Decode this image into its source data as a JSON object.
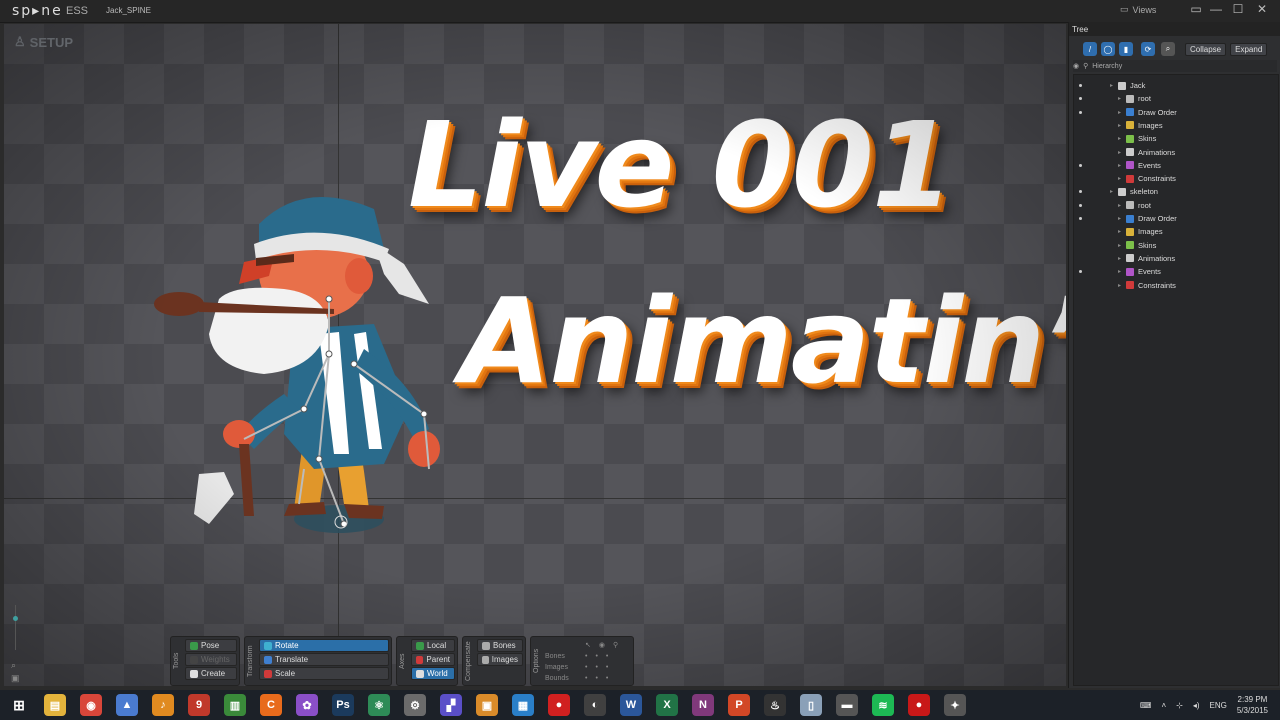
{
  "app": {
    "logo": "sp▸ne",
    "edition": "ESS",
    "project": "Jack_SPINE",
    "views_label": "Views"
  },
  "window_controls": [
    "▭",
    "—",
    "☐",
    "✕"
  ],
  "viewport": {
    "mode": "SETUP"
  },
  "overlay": {
    "line1": "Live 001",
    "line2": "Animatin’"
  },
  "toolbar": {
    "tools": {
      "label": "Tools",
      "pose": "Pose",
      "weights": "Weights",
      "create": "Create"
    },
    "transform": {
      "label": "Transform",
      "rotate": "Rotate",
      "translate": "Translate",
      "scale": "Scale"
    },
    "axes": {
      "label": "Axes",
      "local": "Local",
      "parent": "Parent",
      "world": "World"
    },
    "compensate": {
      "label": "Compensate",
      "bones": "Bones",
      "images": "Images"
    },
    "options": {
      "label": "Options",
      "rows": [
        "Bones",
        "Images",
        "Bounds"
      ]
    }
  },
  "tree": {
    "tab": "Tree",
    "collapse": "Collapse",
    "expand": "Expand",
    "hierarchy": "Hierarchy",
    "items": [
      {
        "label": "Jack",
        "depth": 0,
        "icon": "skeleton",
        "color": "#cccccc",
        "eye": true
      },
      {
        "label": "root",
        "depth": 1,
        "icon": "bone",
        "color": "#bbbbbb",
        "eye": true
      },
      {
        "label": "Draw Order",
        "depth": 1,
        "icon": "draworder",
        "color": "#3a7fd0",
        "eye": true
      },
      {
        "label": "Images",
        "depth": 1,
        "icon": "folder",
        "color": "#d9b23a",
        "eye": false
      },
      {
        "label": "Skins",
        "depth": 1,
        "icon": "skins",
        "color": "#7cc04a",
        "eye": false
      },
      {
        "label": "Animations",
        "depth": 1,
        "icon": "anim",
        "color": "#cccccc",
        "eye": false
      },
      {
        "label": "Events",
        "depth": 1,
        "icon": "events",
        "color": "#b055c8",
        "eye": true
      },
      {
        "label": "Constraints",
        "depth": 1,
        "icon": "constraints",
        "color": "#d03a3a",
        "eye": false
      },
      {
        "label": "skeleton",
        "depth": 0,
        "icon": "skeleton",
        "color": "#cccccc",
        "eye": true
      },
      {
        "label": "root",
        "depth": 1,
        "icon": "bone",
        "color": "#bbbbbb",
        "eye": true
      },
      {
        "label": "Draw Order",
        "depth": 1,
        "icon": "draworder",
        "color": "#3a7fd0",
        "eye": true
      },
      {
        "label": "Images",
        "depth": 1,
        "icon": "folder",
        "color": "#d9b23a",
        "eye": false
      },
      {
        "label": "Skins",
        "depth": 1,
        "icon": "skins",
        "color": "#7cc04a",
        "eye": false
      },
      {
        "label": "Animations",
        "depth": 1,
        "icon": "anim",
        "color": "#cccccc",
        "eye": false
      },
      {
        "label": "Events",
        "depth": 1,
        "icon": "events",
        "color": "#b055c8",
        "eye": true
      },
      {
        "label": "Constraints",
        "depth": 1,
        "icon": "constraints",
        "color": "#d03a3a",
        "eye": false
      }
    ]
  },
  "taskbar": {
    "apps": [
      {
        "name": "file-explorer",
        "color": "#e2b33c",
        "glyph": "▤"
      },
      {
        "name": "chrome",
        "color": "#d8463a",
        "glyph": "◉"
      },
      {
        "name": "app-blue",
        "color": "#4a7bd0",
        "glyph": "▲"
      },
      {
        "name": "fl-studio",
        "color": "#e08a20",
        "glyph": "♪"
      },
      {
        "name": "app-red",
        "color": "#c0392b",
        "glyph": "9"
      },
      {
        "name": "app-mixer",
        "color": "#3a8a3a",
        "glyph": "▥"
      },
      {
        "name": "app-c",
        "color": "#e86b1c",
        "glyph": "C"
      },
      {
        "name": "picasa",
        "color": "#8a4fc8",
        "glyph": "✿"
      },
      {
        "name": "photoshop",
        "color": "#1b3a5c",
        "glyph": "Ps"
      },
      {
        "name": "app-atom",
        "color": "#2e8b57",
        "glyph": "⚛"
      },
      {
        "name": "settings",
        "color": "#6b6b6b",
        "glyph": "⚙"
      },
      {
        "name": "app-tetris",
        "color": "#5a4fc8",
        "glyph": "▞"
      },
      {
        "name": "app-box",
        "color": "#d98b2a",
        "glyph": "▣"
      },
      {
        "name": "app-film",
        "color": "#2a7fc8",
        "glyph": "▦"
      },
      {
        "name": "app-record",
        "color": "#d02020",
        "glyph": "●"
      },
      {
        "name": "obs",
        "color": "#404040",
        "glyph": "◐"
      },
      {
        "name": "word",
        "color": "#2b579a",
        "glyph": "W"
      },
      {
        "name": "excel",
        "color": "#217346",
        "glyph": "X"
      },
      {
        "name": "onenote",
        "color": "#80397b",
        "glyph": "N"
      },
      {
        "name": "powerpoint",
        "color": "#d24726",
        "glyph": "P"
      },
      {
        "name": "app-flame",
        "color": "#333333",
        "glyph": "♨"
      },
      {
        "name": "app-doc",
        "color": "#8aa0b8",
        "glyph": "▯"
      },
      {
        "name": "app-wacom",
        "color": "#555555",
        "glyph": "▬"
      },
      {
        "name": "spotify",
        "color": "#1db954",
        "glyph": "≋"
      },
      {
        "name": "app-red-circle",
        "color": "#c81818",
        "glyph": "●"
      },
      {
        "name": "spine",
        "color": "#555555",
        "glyph": "✦"
      }
    ],
    "lang": "ENG",
    "time": "2:39 PM",
    "date": "5/3/2015"
  }
}
